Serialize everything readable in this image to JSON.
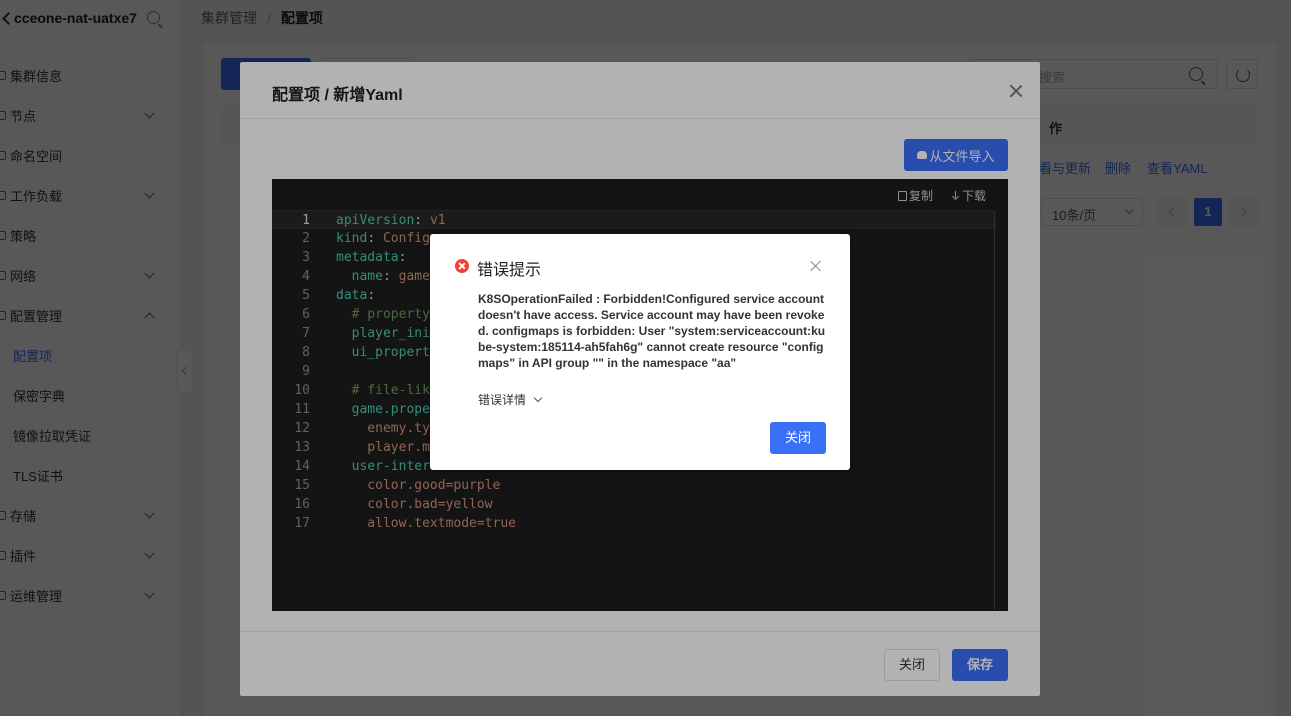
{
  "sidebar": {
    "title": "cceone-nat-uatxe7",
    "items": [
      {
        "label": "集群信息"
      },
      {
        "label": "节点"
      },
      {
        "label": "命名空间"
      },
      {
        "label": "工作负载"
      },
      {
        "label": "策略"
      },
      {
        "label": "网络"
      },
      {
        "label": "配置管理"
      },
      {
        "label": "配置项"
      },
      {
        "label": "保密字典"
      },
      {
        "label": "镜像拉取凭证"
      },
      {
        "label": "TLS证书"
      },
      {
        "label": "存储"
      },
      {
        "label": "插件"
      },
      {
        "label": "运维管理"
      }
    ]
  },
  "breadcrumb": {
    "parent": "集群管理",
    "sep": "/",
    "current": "配置项"
  },
  "background": {
    "search_placeholder": "搜索",
    "op_header": "作",
    "links": {
      "view_update": "看与更新",
      "delete": "删除",
      "view_yaml": "查看YAML"
    },
    "page_size": "10条/页",
    "page": "1"
  },
  "yaml_dialog": {
    "title": "配置项 / 新增Yaml",
    "import_label": "从文件导入",
    "copy_label": "复制",
    "download_label": "下载",
    "lines": [
      {
        "n": "1",
        "k": "apiVersion",
        "p": ": ",
        "v": "v1",
        "c": ""
      },
      {
        "n": "2",
        "k": "kind",
        "p": ": ",
        "v": "Config",
        "c": ""
      },
      {
        "n": "3",
        "k": "metadata",
        "p": ":",
        "v": "",
        "c": ""
      },
      {
        "n": "4",
        "k": "  name",
        "p": ": ",
        "v": "game",
        "c": ""
      },
      {
        "n": "5",
        "k": "data",
        "p": ":",
        "v": "",
        "c": ""
      },
      {
        "n": "6",
        "k": "",
        "p": "",
        "v": "",
        "c": "  # property"
      },
      {
        "n": "7",
        "k": "  player_ini",
        "p": "",
        "v": "",
        "c": ""
      },
      {
        "n": "8",
        "k": "  ui_propert",
        "p": "",
        "v": "",
        "c": ""
      },
      {
        "n": "9",
        "k": "",
        "p": "",
        "v": "",
        "c": ""
      },
      {
        "n": "10",
        "k": "",
        "p": "",
        "v": "",
        "c": "  # file-lik"
      },
      {
        "n": "11",
        "k": "  game.prope",
        "p": "",
        "v": "",
        "c": ""
      },
      {
        "n": "12",
        "k": "",
        "p": "",
        "v": "    enemy.ty",
        "c": ""
      },
      {
        "n": "13",
        "k": "",
        "p": "",
        "v": "    player.m",
        "c": ""
      },
      {
        "n": "14",
        "k": "  user-inter",
        "p": "",
        "v": "",
        "c": ""
      },
      {
        "n": "15",
        "k": "",
        "p": "",
        "v": "    color.good=purple",
        "c": ""
      },
      {
        "n": "16",
        "k": "",
        "p": "",
        "v": "    color.bad=yellow",
        "c": ""
      },
      {
        "n": "17",
        "k": "",
        "p": "",
        "v": "    allow.textmode=true",
        "c": ""
      }
    ],
    "cancel_label": "关闭",
    "save_label": "保存"
  },
  "error_dialog": {
    "title": "错误提示",
    "message": "K8SOperationFailed :  Forbidden!Configured service account doesn't have access. Service account may have been revoked. configmaps is forbidden: User \"system:serviceaccount:kube-system:185114-ah5fah6g\" cannot create resource \"configmaps\" in API group \"\" in the namespace \"aa\"",
    "detail_label": "错误详情",
    "close_label": "关闭"
  },
  "colors": {
    "primary": "#3a6ff7",
    "error": "#f04134",
    "editor_bg": "#1e1e1e"
  }
}
